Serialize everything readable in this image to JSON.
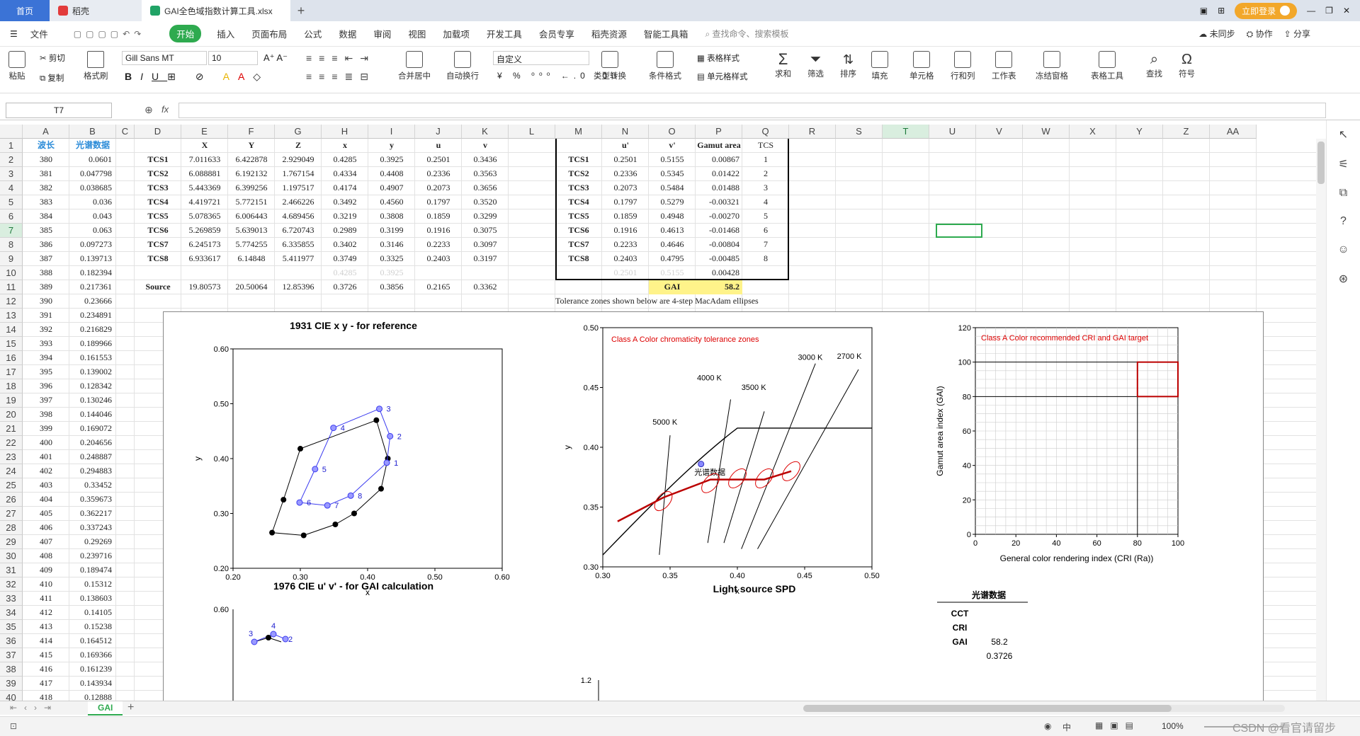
{
  "tabs": {
    "home": "首页",
    "daoke": "稻壳",
    "file": "GAI全色域指数计算工具.xlsx"
  },
  "top_right": {
    "login": "立即登录"
  },
  "menu": [
    "文件",
    "开始",
    "插入",
    "页面布局",
    "公式",
    "数据",
    "审阅",
    "视图",
    "加载项",
    "开发工具",
    "会员专享",
    "稻壳资源",
    "智能工具箱"
  ],
  "search_placeholder": "查找命令、搜索模板",
  "menu_right": {
    "sync": "未同步",
    "collab": "协作",
    "share": "分享"
  },
  "ribbon": {
    "paste": "粘贴",
    "cut": "剪切",
    "copy": "复制",
    "format_painter": "格式刷",
    "font": "Gill Sans MT",
    "size": "10",
    "numfmt": "自定义",
    "merge": "合并居中",
    "wrap": "自动换行",
    "type_convert": "类型转换",
    "cond_format": "条件格式",
    "table_style": "表格样式",
    "cell_style": "单元格样式",
    "sum": "求和",
    "filter": "筛选",
    "sort": "排序",
    "fill": "填充",
    "cell": "单元格",
    "rowcol": "行和列",
    "worksheet": "工作表",
    "freeze": "冻结窗格",
    "table_tools": "表格工具",
    "find": "查找",
    "symbol": "符号"
  },
  "namebox": "T7",
  "fx": "fx",
  "columns": [
    "A",
    "B",
    "C",
    "D",
    "E",
    "F",
    "G",
    "H",
    "I",
    "J",
    "K",
    "L",
    "M",
    "N",
    "O",
    "P",
    "Q",
    "R",
    "S",
    "T",
    "U",
    "V",
    "W",
    "X",
    "Y",
    "Z",
    "AA"
  ],
  "colA_header": "波长",
  "colB_header": "光谱数据",
  "wavelengths": [
    "380",
    "381",
    "382",
    "383",
    "384",
    "385",
    "386",
    "387",
    "388",
    "389",
    "390",
    "391",
    "392",
    "393",
    "394",
    "395",
    "396",
    "397",
    "398",
    "399",
    "400",
    "401",
    "402",
    "403",
    "404",
    "405",
    "406",
    "407",
    "408",
    "409",
    "410",
    "411",
    "412",
    "413",
    "414",
    "415",
    "416",
    "417",
    "418"
  ],
  "spectral": [
    "0.0601",
    "0.047798",
    "0.038685",
    "0.036",
    "0.043",
    "0.063",
    "0.097273",
    "0.139713",
    "0.182394",
    "0.217361",
    "0.23666",
    "0.234891",
    "0.216829",
    "0.189966",
    "0.161553",
    "0.139002",
    "0.128342",
    "0.130246",
    "0.144046",
    "0.169072",
    "0.204656",
    "0.248887",
    "0.294883",
    "0.33452",
    "0.359673",
    "0.362217",
    "0.337243",
    "0.29269",
    "0.239716",
    "0.189474",
    "0.15312",
    "0.138603",
    "0.14105",
    "0.15238",
    "0.164512",
    "0.169366",
    "0.161239",
    "0.143934",
    "0.12888"
  ],
  "xyz_headers": [
    "X",
    "Y",
    "Z",
    "x",
    "y",
    "u",
    "v"
  ],
  "tcs_rows": [
    [
      "TCS1",
      "7.011633",
      "6.422878",
      "2.929049",
      "0.4285",
      "0.3925",
      "0.2501",
      "0.3436"
    ],
    [
      "TCS2",
      "6.088881",
      "6.192132",
      "1.767154",
      "0.4334",
      "0.4408",
      "0.2336",
      "0.3563"
    ],
    [
      "TCS3",
      "5.443369",
      "6.399256",
      "1.197517",
      "0.4174",
      "0.4907",
      "0.2073",
      "0.3656"
    ],
    [
      "TCS4",
      "4.419721",
      "5.772151",
      "2.466226",
      "0.3492",
      "0.4560",
      "0.1797",
      "0.3520"
    ],
    [
      "TCS5",
      "5.078365",
      "6.006443",
      "4.689456",
      "0.3219",
      "0.3808",
      "0.1859",
      "0.3299"
    ],
    [
      "TCS6",
      "5.269859",
      "5.639013",
      "6.720743",
      "0.2989",
      "0.3199",
      "0.1916",
      "0.3075"
    ],
    [
      "TCS7",
      "6.245173",
      "5.774255",
      "6.335855",
      "0.3402",
      "0.3146",
      "0.2233",
      "0.3097"
    ],
    [
      "TCS8",
      "6.933617",
      "6.14848",
      "5.411977",
      "0.3749",
      "0.3325",
      "0.2403",
      "0.3197"
    ]
  ],
  "row10": [
    "0.4285",
    "0.3925"
  ],
  "source_row": [
    "Source",
    "19.80573",
    "20.50064",
    "12.85396",
    "0.3726",
    "0.3856",
    "0.2165",
    "0.3362"
  ],
  "uv_headers": [
    "u'",
    "v'",
    "Gamut area",
    "TCS"
  ],
  "uv_rows": [
    [
      "TCS1",
      "0.2501",
      "0.5155",
      "0.00867",
      "1"
    ],
    [
      "TCS2",
      "0.2336",
      "0.5345",
      "0.01422",
      "2"
    ],
    [
      "TCS3",
      "0.2073",
      "0.5484",
      "0.01488",
      "3"
    ],
    [
      "TCS4",
      "0.1797",
      "0.5279",
      "-0.00321",
      "4"
    ],
    [
      "TCS5",
      "0.1859",
      "0.4948",
      "-0.00270",
      "5"
    ],
    [
      "TCS6",
      "0.1916",
      "0.4613",
      "-0.01468",
      "6"
    ],
    [
      "TCS7",
      "0.2233",
      "0.4646",
      "-0.00804",
      "7"
    ],
    [
      "TCS8",
      "0.2403",
      "0.4795",
      "-0.00485",
      "8"
    ]
  ],
  "row10_uv": [
    "0.2501",
    "0.5155",
    "0.00428"
  ],
  "gai_label": "GAI",
  "gai_value": "58.2",
  "tolerance_note": "Tolerance zones shown below are 4-step MacAdam ellipses",
  "chart_data": [
    {
      "type": "scatter",
      "title": "1931 CIE x y - for reference",
      "xlabel": "x",
      "ylabel": "y",
      "xlim": [
        0.2,
        0.6
      ],
      "ylim": [
        0.2,
        0.6
      ],
      "xticks": [
        "0.20",
        "0.30",
        "0.40",
        "0.50",
        "0.60"
      ],
      "yticks": [
        "0.20",
        "0.30",
        "0.40",
        "0.50",
        "0.60"
      ],
      "series": [
        {
          "values": [
            [
              0.4285,
              0.3925
            ],
            [
              0.4334,
              0.4408
            ],
            [
              0.4174,
              0.4907
            ],
            [
              0.3492,
              0.456
            ],
            [
              0.3219,
              0.3808
            ],
            [
              0.2989,
              0.3199
            ],
            [
              0.3402,
              0.3146
            ],
            [
              0.3749,
              0.3325
            ]
          ],
          "labels": [
            "1",
            "2",
            "3",
            "4",
            "5",
            "6",
            "7",
            "8"
          ]
        },
        {
          "values": [
            [
              0.305,
              0.26
            ],
            [
              0.352,
              0.28
            ],
            [
              0.38,
              0.3
            ],
            [
              0.42,
              0.345
            ],
            [
              0.43,
              0.4
            ],
            [
              0.413,
              0.47
            ],
            [
              0.3,
              0.418
            ],
            [
              0.275,
              0.325
            ],
            [
              0.258,
              0.265
            ]
          ]
        }
      ]
    },
    {
      "type": "line",
      "title": "Class A Color chromaticity tolerance zones",
      "xlabel": "x",
      "ylabel": "y",
      "xlim": [
        0.3,
        0.5
      ],
      "ylim": [
        0.3,
        0.5
      ],
      "xticks": [
        "0.30",
        "0.35",
        "0.40",
        "0.45",
        "0.50"
      ],
      "yticks": [
        "0.30",
        "0.35",
        "0.40",
        "0.45",
        "0.50"
      ],
      "annotations": [
        "5000 K",
        "4000 K",
        "3500 K",
        "3000 K",
        "2700 K",
        "光谱数据"
      ]
    },
    {
      "type": "line",
      "title": "Class A Color recommended CRI and GAI target",
      "xlabel": "General color rendering index (CRI (Ra))",
      "ylabel": "Gamut area index (GAI)",
      "xlim": [
        0,
        100
      ],
      "ylim": [
        0,
        120
      ],
      "xticks": [
        "0",
        "20",
        "40",
        "60",
        "80",
        "100"
      ],
      "yticks": [
        "0",
        "20",
        "40",
        "60",
        "80",
        "100",
        "120"
      ]
    },
    {
      "type": "scatter",
      "title": "1976 CIE u' v' - for GAI calculation",
      "yticks": [
        "0.60"
      ],
      "labels": [
        "3",
        "4",
        "2"
      ]
    },
    {
      "type": "line",
      "title": "Light source SPD",
      "yticks": [
        "1.2"
      ]
    }
  ],
  "summary_title": "光谱数据",
  "summary_rows": [
    [
      "CCT",
      ""
    ],
    [
      "CRI",
      ""
    ],
    [
      "GAI",
      "58.2"
    ],
    [
      "",
      "0.3726"
    ]
  ],
  "sheet": "GAI",
  "status": {
    "zoom": "100%",
    "ime": "中",
    "watermark": "CSDN @看官请留步"
  }
}
